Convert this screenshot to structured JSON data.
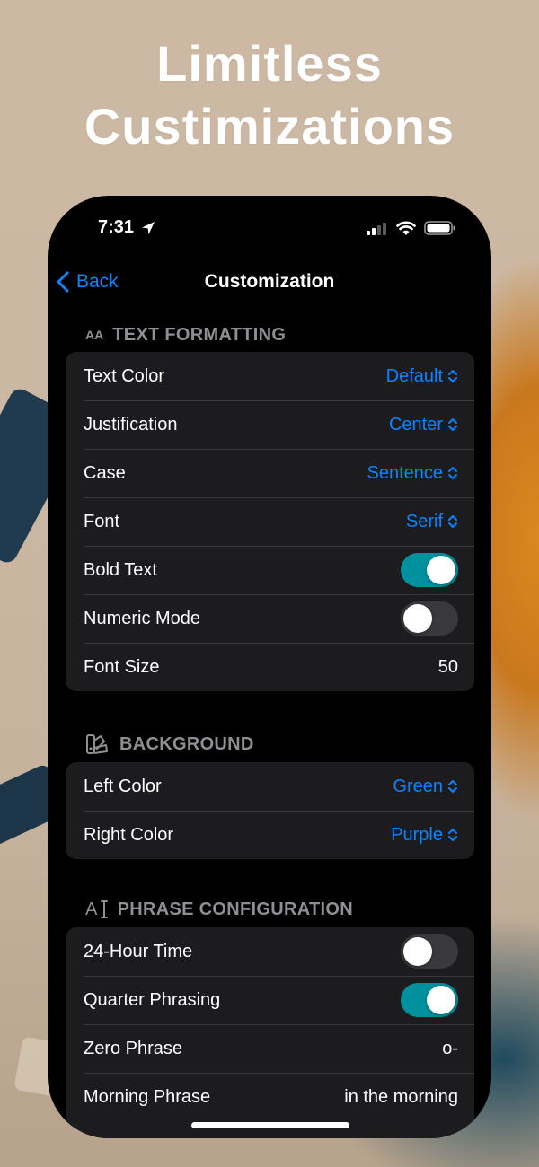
{
  "headline": {
    "line1": "Limitless",
    "line2": "Custimizations"
  },
  "status_bar": {
    "time": "7:31",
    "icons": [
      "location-arrow-icon",
      "signal-icon",
      "wifi-icon",
      "battery-icon"
    ]
  },
  "nav": {
    "back_label": "Back",
    "title": "Customization"
  },
  "sections": {
    "text_formatting": {
      "icon": "text-size-icon",
      "icon_text": "AA",
      "title": "TEXT FORMATTING",
      "rows": {
        "text_color": {
          "label": "Text Color",
          "value": "Default"
        },
        "justification": {
          "label": "Justification",
          "value": "Center"
        },
        "case": {
          "label": "Case",
          "value": "Sentence"
        },
        "font": {
          "label": "Font",
          "value": "Serif"
        },
        "bold_text": {
          "label": "Bold Text",
          "on": true
        },
        "numeric_mode": {
          "label": "Numeric Mode",
          "on": false
        },
        "font_size": {
          "label": "Font Size",
          "value": "50"
        }
      }
    },
    "background": {
      "icon": "swatch-palette-icon",
      "title": "BACKGROUND",
      "rows": {
        "left_color": {
          "label": "Left Color",
          "value": "Green"
        },
        "right_color": {
          "label": "Right Color",
          "value": "Purple"
        }
      }
    },
    "phrase_configuration": {
      "icon": "text-cursor-icon",
      "icon_text": "A",
      "title": "PHRASE CONFIGURATION",
      "rows": {
        "hour24": {
          "label": "24-Hour Time",
          "on": false
        },
        "quarter_phrasing": {
          "label": "Quarter Phrasing",
          "on": true
        },
        "zero_phrase": {
          "label": "Zero Phrase",
          "value": "o-"
        },
        "morning_phrase": {
          "label": "Morning Phrase",
          "value": "in the morning"
        }
      }
    }
  },
  "colors": {
    "accent": "#0a84ff",
    "toggle_on": "#00909e",
    "cell": "#1c1c1e",
    "phone_bg": "#000000",
    "header": "#8e8e93"
  }
}
